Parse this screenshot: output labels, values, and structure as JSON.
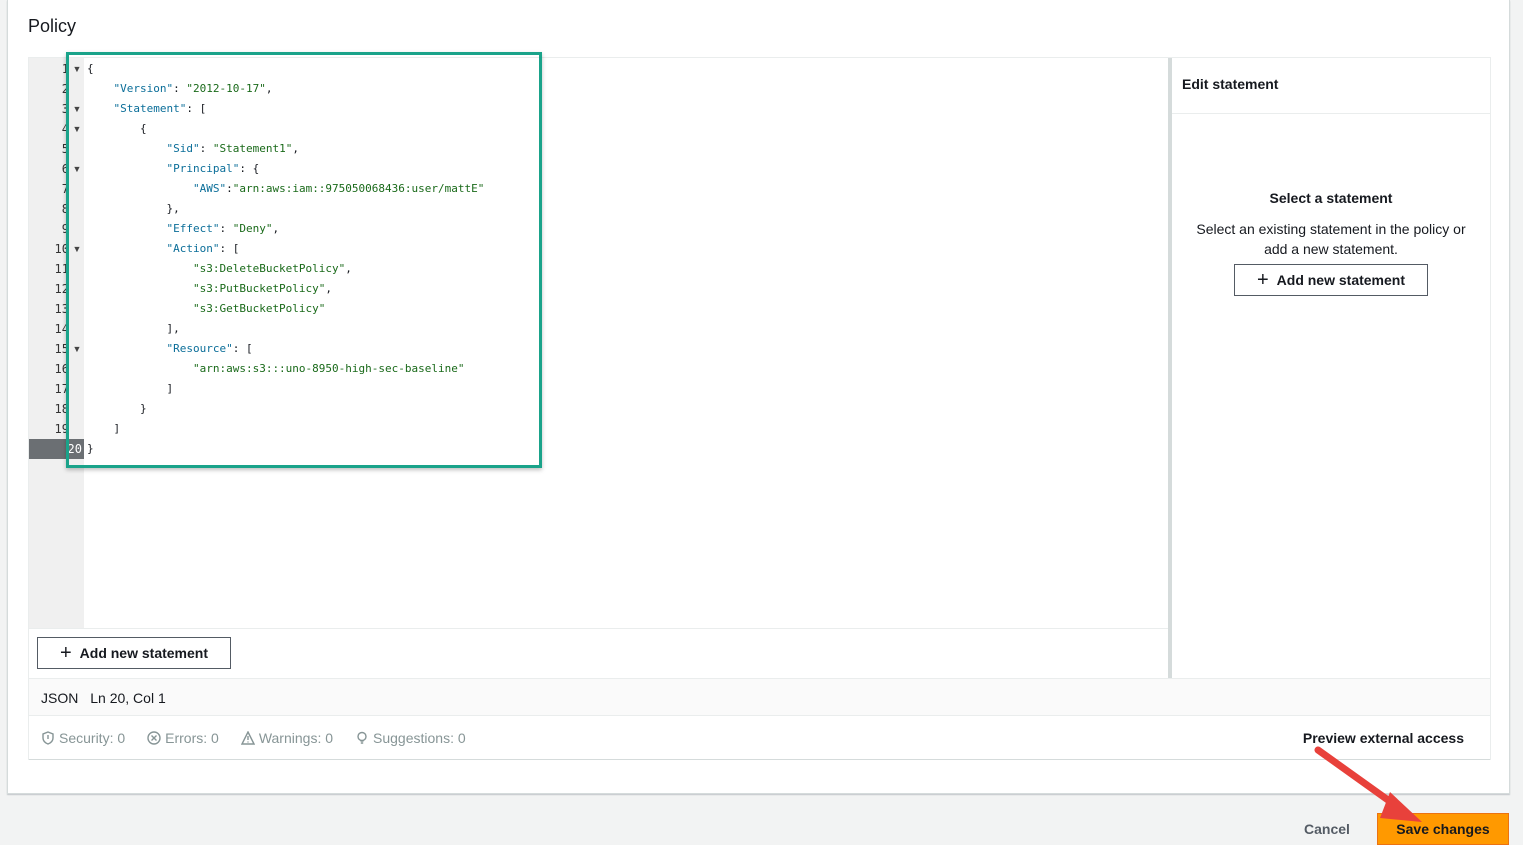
{
  "policy": {
    "title": "Policy"
  },
  "editor": {
    "line_numbers": [
      "1",
      "2",
      "3",
      "4",
      "5",
      "6",
      "7",
      "8",
      "9",
      "10",
      "11",
      "12",
      "13",
      "14",
      "15",
      "16",
      "17",
      "18",
      "19",
      "20"
    ],
    "active_line": 20,
    "code_lines": [
      "{",
      "    \"Version\": \"2012-10-17\",",
      "    \"Statement\": [",
      "        {",
      "            \"Sid\": \"Statement1\",",
      "            \"Principal\": {",
      "                \"AWS\":\"arn:aws:iam::975050068436:user/mattE\"",
      "            },",
      "            \"Effect\": \"Deny\",",
      "            \"Action\": [",
      "                \"s3:DeleteBucketPolicy\",",
      "                \"s3:PutBucketPolicy\",",
      "                \"s3:GetBucketPolicy\"",
      "            ],",
      "            \"Resource\": [",
      "                \"arn:aws:s3:::uno-8950-high-sec-baseline\"",
      "            ]",
      "        }",
      "    ]",
      "}"
    ],
    "add_statement_label": "Add new statement"
  },
  "side_panel": {
    "header": "Edit statement",
    "empty_title": "Select a statement",
    "empty_description": "Select an existing statement in the policy or add a new statement.",
    "add_statement_label": "Add new statement"
  },
  "status": {
    "language": "JSON",
    "position": "Ln 20, Col 1"
  },
  "validation": {
    "security": "Security: 0",
    "errors": "Errors: 0",
    "warnings": "Warnings: 0",
    "suggestions": "Suggestions: 0",
    "preview_label": "Preview external access"
  },
  "footer": {
    "cancel_label": "Cancel",
    "save_label": "Save changes"
  },
  "colors": {
    "highlight_box": "#1aa38a",
    "save_button": "#ff9900",
    "arrow": "#e8413b"
  }
}
